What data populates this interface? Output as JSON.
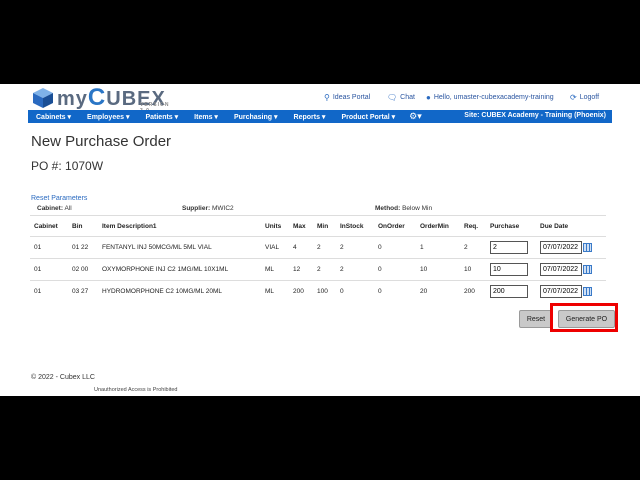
{
  "logo": {
    "text_before": "my",
    "text_c": "C",
    "text_after": "UBEX",
    "version": "VERSION 3.0"
  },
  "toplinks": {
    "ideas": "Ideas Portal",
    "chat": "Chat",
    "hello": "Hello, umaster-cubexacademy-training",
    "logoff": "Logoff"
  },
  "nav": {
    "items": [
      "Cabinets",
      "Employees",
      "Patients",
      "Items",
      "Purchasing",
      "Reports",
      "Product Portal"
    ],
    "site": "Site: CUBEX Academy - Training (Phoenix)"
  },
  "page": {
    "title": "New Purchase Order",
    "po": "PO #: 1070W",
    "reset_params": "Reset Parameters",
    "filters": {
      "cabinet_label": "Cabinet:",
      "cabinet_value": "All",
      "supplier_label": "Supplier:",
      "supplier_value": "MWIC2",
      "method_label": "Method:",
      "method_value": "Below Min"
    }
  },
  "table": {
    "headers": [
      "Cabinet",
      "Bin",
      "Item Description1",
      "Units",
      "Max",
      "Min",
      "InStock",
      "OnOrder",
      "OrderMin",
      "Req.",
      "Purchase",
      "Due Date"
    ],
    "rows": [
      [
        "01",
        "01 22",
        "FENTANYL INJ 50MCG/ML 5ML VIAL",
        "VIAL",
        "4",
        "2",
        "2",
        "0",
        "1",
        "2",
        "2",
        "07/07/2022"
      ],
      [
        "01",
        "02 00",
        "OXYMORPHONE INJ C2 1MG/ML 10X1ML",
        "ML",
        "12",
        "2",
        "2",
        "0",
        "10",
        "10",
        "10",
        "07/07/2022"
      ],
      [
        "01",
        "03 27",
        "HYDROMORPHONE C2 10MG/ML 20ML",
        "ML",
        "200",
        "100",
        "0",
        "0",
        "20",
        "200",
        "200",
        "07/07/2022"
      ]
    ]
  },
  "buttons": {
    "reset": "Reset",
    "generate": "Generate PO"
  },
  "footer": {
    "copyright": "© 2022 - Cubex LLC",
    "unauthorized": "Unauthorized Access is Prohibited"
  },
  "colors": {
    "nav": "#1167c8",
    "link": "#2a6ac0",
    "highlight": "#e00000"
  }
}
